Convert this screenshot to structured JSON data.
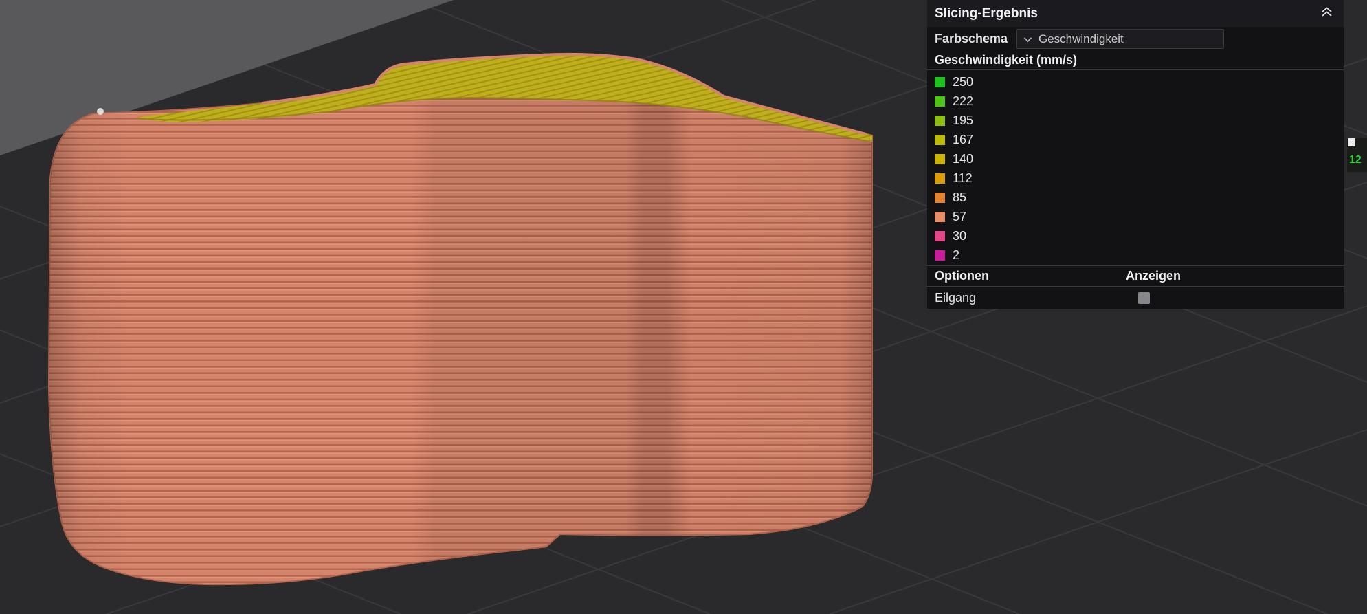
{
  "panel": {
    "title": "Slicing-Ergebnis",
    "collapse_icon": "chevron-double-up",
    "color_scheme": {
      "label": "Farbschema",
      "dropdown_icon": "chevron-down",
      "selected": "Geschwindigkeit"
    },
    "legend": {
      "title": "Geschwindigkeit (mm/s)",
      "items": [
        {
          "value": "250",
          "color": "#1dc41d"
        },
        {
          "value": "222",
          "color": "#4cc414"
        },
        {
          "value": "195",
          "color": "#8cc00c"
        },
        {
          "value": "167",
          "color": "#bcbc04"
        },
        {
          "value": "140",
          "color": "#ccb400"
        },
        {
          "value": "112",
          "color": "#dc9c04"
        },
        {
          "value": "85",
          "color": "#e4842c"
        },
        {
          "value": "57",
          "color": "#e88c64"
        },
        {
          "value": "30",
          "color": "#e4468c"
        },
        {
          "value": "2",
          "color": "#cc1c9c"
        }
      ]
    },
    "options": {
      "header_left": "Optionen",
      "header_right": "Anzeigen",
      "rows": [
        {
          "label": "Eilgang",
          "checked": false
        }
      ]
    }
  },
  "viewport": {
    "layer_indicator": "12",
    "layer_indicator_color": "#2fd12f",
    "scene_colors": {
      "background": "#59595b",
      "plate": "#2a2a2c",
      "grid_line": "#39393c",
      "model_wall": "#d5846c",
      "model_wall_shadow": "#b3654e",
      "model_wall_highlight": "#eda184",
      "model_top": "#bfae1e",
      "model_top_line": "#9f900e"
    }
  }
}
